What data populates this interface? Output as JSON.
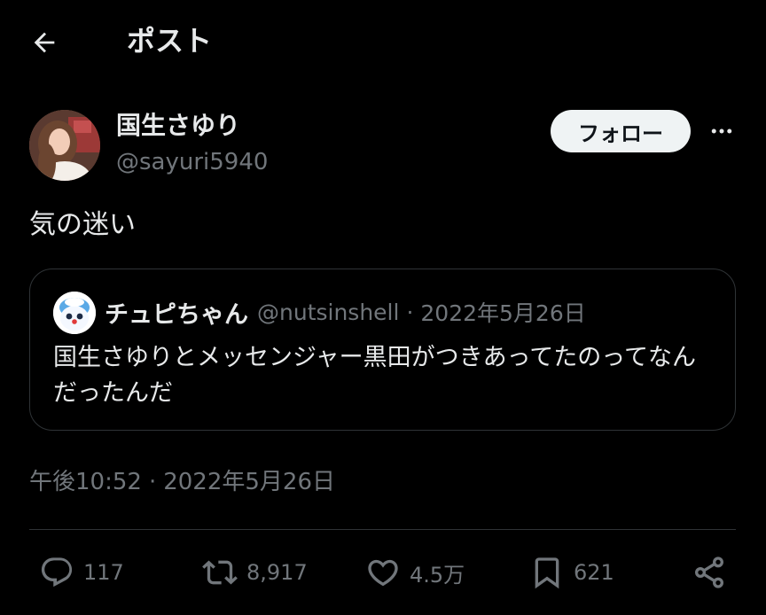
{
  "header": {
    "title": "ポスト",
    "back_icon": "arrow-left-icon"
  },
  "author": {
    "display_name": "国生さゆり",
    "handle": "@sayuri5940",
    "follow_label": "フォロー"
  },
  "post": {
    "text": "気の迷い"
  },
  "quote": {
    "display_name": "チュピちゃん",
    "handle": "@nutsinshell",
    "separator": "·",
    "date": "2022年5月26日",
    "text": "国生さゆりとメッセンジャー黒田がつきあってたのってなんだったんだ"
  },
  "meta": {
    "time": "午後10:52",
    "separator": "·",
    "date": "2022年5月26日"
  },
  "actions": {
    "replies": "117",
    "reposts": "8,917",
    "likes": "4.5万",
    "bookmarks": "621"
  },
  "colors": {
    "background": "#000000",
    "text": "#e7e9ea",
    "muted": "#71767b",
    "border": "#2f3336",
    "follow_bg": "#eff3f4"
  }
}
